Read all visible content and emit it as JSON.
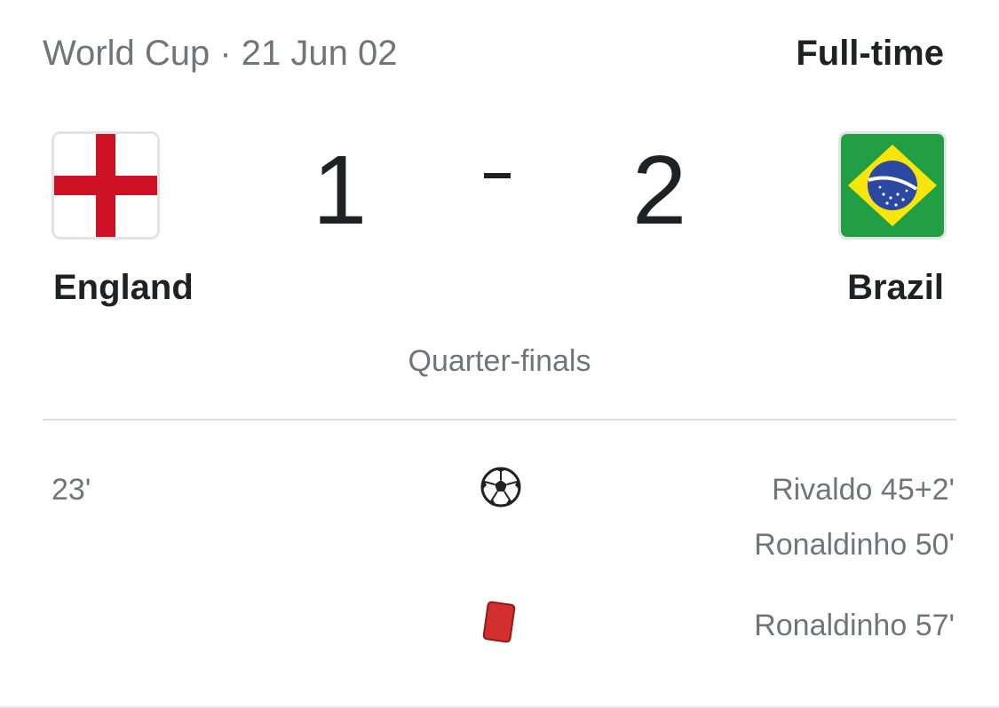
{
  "header": {
    "competition_date": "World Cup · 21 Jun 02",
    "status": "Full-time"
  },
  "home": {
    "name": "England",
    "score": "1",
    "flag_icon": "england-flag-icon"
  },
  "away": {
    "name": "Brazil",
    "score": "2",
    "flag_icon": "brazil-flag-icon"
  },
  "separator": "-",
  "stage": "Quarter-finals",
  "events": {
    "home_goals": [
      "23'"
    ],
    "away_goals": [
      "Rivaldo 45+2'",
      "Ronaldinho 50'"
    ],
    "away_red_cards": [
      "Ronaldinho 57'"
    ],
    "goal_icon": "soccer-ball-icon",
    "red_card_icon": "red-card-icon"
  },
  "colors": {
    "england_red": "#ce1124",
    "brazil_green": "#229e45",
    "brazil_yellow": "#f8e509",
    "brazil_blue": "#2b49a3",
    "red_card": "#d32f2f",
    "muted_text": "#70757a",
    "primary_text": "#202124"
  }
}
